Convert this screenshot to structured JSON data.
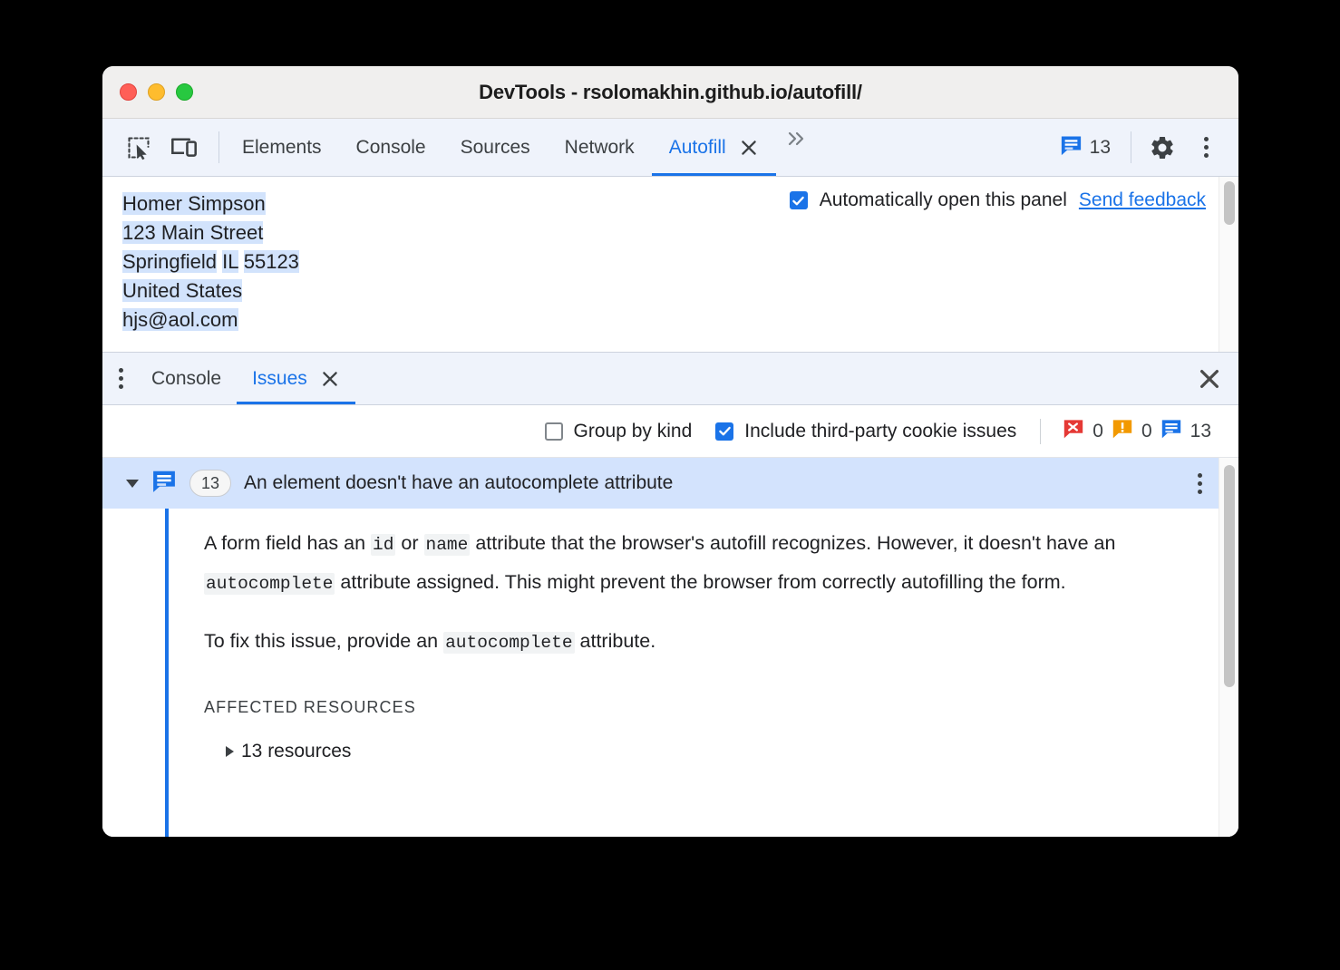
{
  "window": {
    "title": "DevTools - rsolomakhin.github.io/autofill/",
    "traffic_lights": [
      "close",
      "minimize",
      "maximize"
    ],
    "colors": {
      "close": "#ff5f57",
      "minimize": "#febc2e",
      "maximize": "#28c840"
    }
  },
  "accent": "#1a73e8",
  "toolbar": {
    "inspect_icon": "inspect-cursor-icon",
    "device_icon": "device-toolbar-icon",
    "tabs": [
      {
        "label": "Elements",
        "active": false,
        "closable": false
      },
      {
        "label": "Console",
        "active": false,
        "closable": false
      },
      {
        "label": "Sources",
        "active": false,
        "closable": false
      },
      {
        "label": "Network",
        "active": false,
        "closable": false
      },
      {
        "label": "Autofill",
        "active": true,
        "closable": true
      }
    ],
    "more_tabs_icon": "double-chevron-right-icon",
    "issues_badge": {
      "icon": "issue-message-icon",
      "count": "13"
    },
    "settings_icon": "gear-icon",
    "more_options_icon": "more-vertical-icon"
  },
  "autofill": {
    "address_lines": [
      [
        {
          "t": "Homer Simpson",
          "hl": true
        }
      ],
      [
        {
          "t": "123 Main Street",
          "hl": true
        }
      ],
      [
        {
          "t": "Springfield",
          "hl": true
        },
        {
          "t": " ",
          "hl": false
        },
        {
          "t": "IL",
          "hl": true
        },
        {
          "t": " ",
          "hl": false
        },
        {
          "t": "55123",
          "hl": true
        }
      ],
      [
        {
          "t": "United States",
          "hl": true
        }
      ],
      [
        {
          "t": "hjs@aol.com",
          "hl": true
        }
      ]
    ],
    "auto_open_checkbox": {
      "label": "Automatically open this panel",
      "checked": true
    },
    "send_feedback_link": "Send feedback"
  },
  "drawer": {
    "more_icon": "more-vertical-icon",
    "tabs": [
      {
        "label": "Console",
        "active": false,
        "closable": false
      },
      {
        "label": "Issues",
        "active": true,
        "closable": true
      }
    ],
    "close_icon": "close-icon"
  },
  "issues_toolbar": {
    "group_by_kind": {
      "label": "Group by kind",
      "checked": false
    },
    "include_third_party": {
      "label": "Include third-party cookie issues",
      "checked": true
    },
    "counts": [
      {
        "kind": "error",
        "icon": "error-issue-icon",
        "color": "#e53935",
        "value": "0"
      },
      {
        "kind": "warning",
        "icon": "warning-issue-icon",
        "color": "#f29900",
        "value": "0"
      },
      {
        "kind": "info",
        "icon": "info-issue-icon",
        "color": "#1a73e8",
        "value": "13"
      }
    ]
  },
  "issue": {
    "expanded": true,
    "icon": "info-issue-icon",
    "count_badge": "13",
    "title": "An element doesn't have an autocomplete attribute",
    "row_menu_icon": "more-vertical-icon",
    "paragraph1": {
      "parts": [
        {
          "t": "A form field has an ",
          "code": false
        },
        {
          "t": "id",
          "code": true
        },
        {
          "t": " or ",
          "code": false
        },
        {
          "t": "name",
          "code": true
        },
        {
          "t": " attribute that the browser's autofill recognizes. However, it doesn't have an ",
          "code": false
        },
        {
          "t": "autocomplete",
          "code": true
        },
        {
          "t": " attribute assigned. This might prevent the browser from correctly autofilling the form.",
          "code": false
        }
      ]
    },
    "paragraph2": {
      "parts": [
        {
          "t": "To fix this issue, provide an ",
          "code": false
        },
        {
          "t": "autocomplete",
          "code": true
        },
        {
          "t": " attribute.",
          "code": false
        }
      ]
    },
    "affected_resources_title": "AFFECTED RESOURCES",
    "resources_label": "13 resources",
    "resources_expanded": false
  }
}
